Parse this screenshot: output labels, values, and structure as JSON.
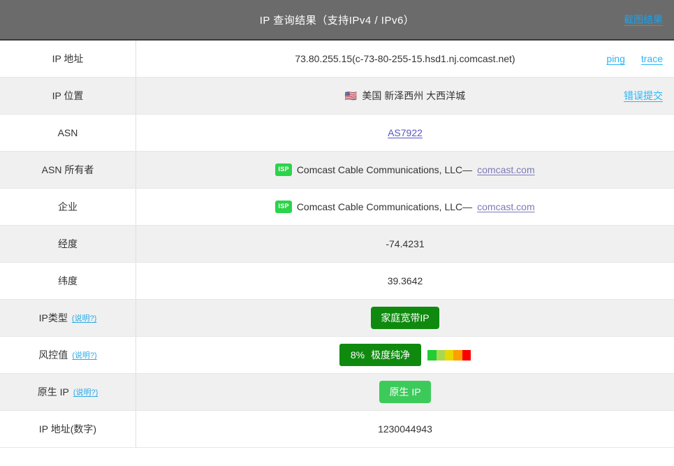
{
  "header": {
    "title": "IP 查询结果（支持IPv4 / IPv6）",
    "action_label": "截图结果"
  },
  "colors": {
    "header_bg": "#6b6b6b",
    "link_cyan": "#29b6f6",
    "link_asn": "#5656c8",
    "link_domain": "#7a79b8",
    "badge_green": "#2bd44a",
    "pill_dark_green": "#0f8a0f",
    "pill_light_green": "#3ccb5a",
    "row_even_bg": "#f0f0f0",
    "row_odd_bg": "#ffffff"
  },
  "rows": {
    "ip_address": {
      "label": "IP 地址",
      "value": "73.80.255.15(c-73-80-255-15.hsd1.nj.comcast.net)",
      "action_ping": "ping",
      "action_trace": "trace"
    },
    "ip_location": {
      "label": "IP 位置",
      "flag": "🇺🇸",
      "value": "美国 新泽西州 大西洋城",
      "action_report": "错误提交"
    },
    "asn": {
      "label": "ASN",
      "value": "AS7922"
    },
    "asn_owner": {
      "label": "ASN 所有者",
      "badge": "ISP",
      "value": "Comcast Cable Communications, LLC—",
      "domain": "comcast.com"
    },
    "enterprise": {
      "label": "企业",
      "badge": "ISP",
      "value": "Comcast Cable Communications, LLC—",
      "domain": "comcast.com"
    },
    "longitude": {
      "label": "经度",
      "value": "-74.4231"
    },
    "latitude": {
      "label": "纬度",
      "value": "39.3642"
    },
    "ip_type": {
      "label": "IP类型",
      "explain": "(说明?)",
      "value": "家庭宽带IP"
    },
    "risk_value": {
      "label": "风控值",
      "explain": "(说明?)",
      "percent": "8%",
      "rating": "极度纯净",
      "scale_colors": [
        "#22cc33",
        "#a8d84f",
        "#e8d800",
        "#ff9f00",
        "#fc0000"
      ]
    },
    "native_ip": {
      "label": "原生 IP",
      "explain": "(说明?)",
      "value": "原生 IP"
    },
    "ip_numeric": {
      "label": "IP 地址(数字)",
      "value": "1230044943"
    }
  }
}
